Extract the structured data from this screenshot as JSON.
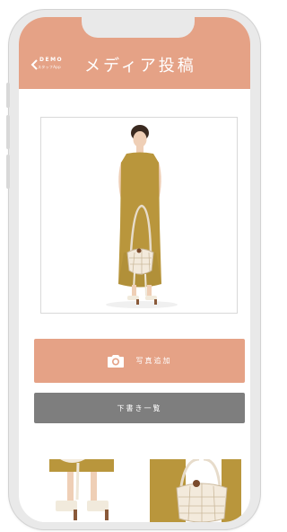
{
  "header": {
    "brand": "DEMO",
    "brand_sub": "スタッフApp",
    "title": "メディア投稿"
  },
  "actions": {
    "add_photo_label": "写真追加",
    "drafts_label": "下書き一覧"
  },
  "colors": {
    "accent": "#e5a286",
    "secondary_button": "#7e7e7e",
    "dress": "#b9963c"
  },
  "icons": {
    "back": "chevron-left-icon",
    "camera": "camera-icon"
  }
}
